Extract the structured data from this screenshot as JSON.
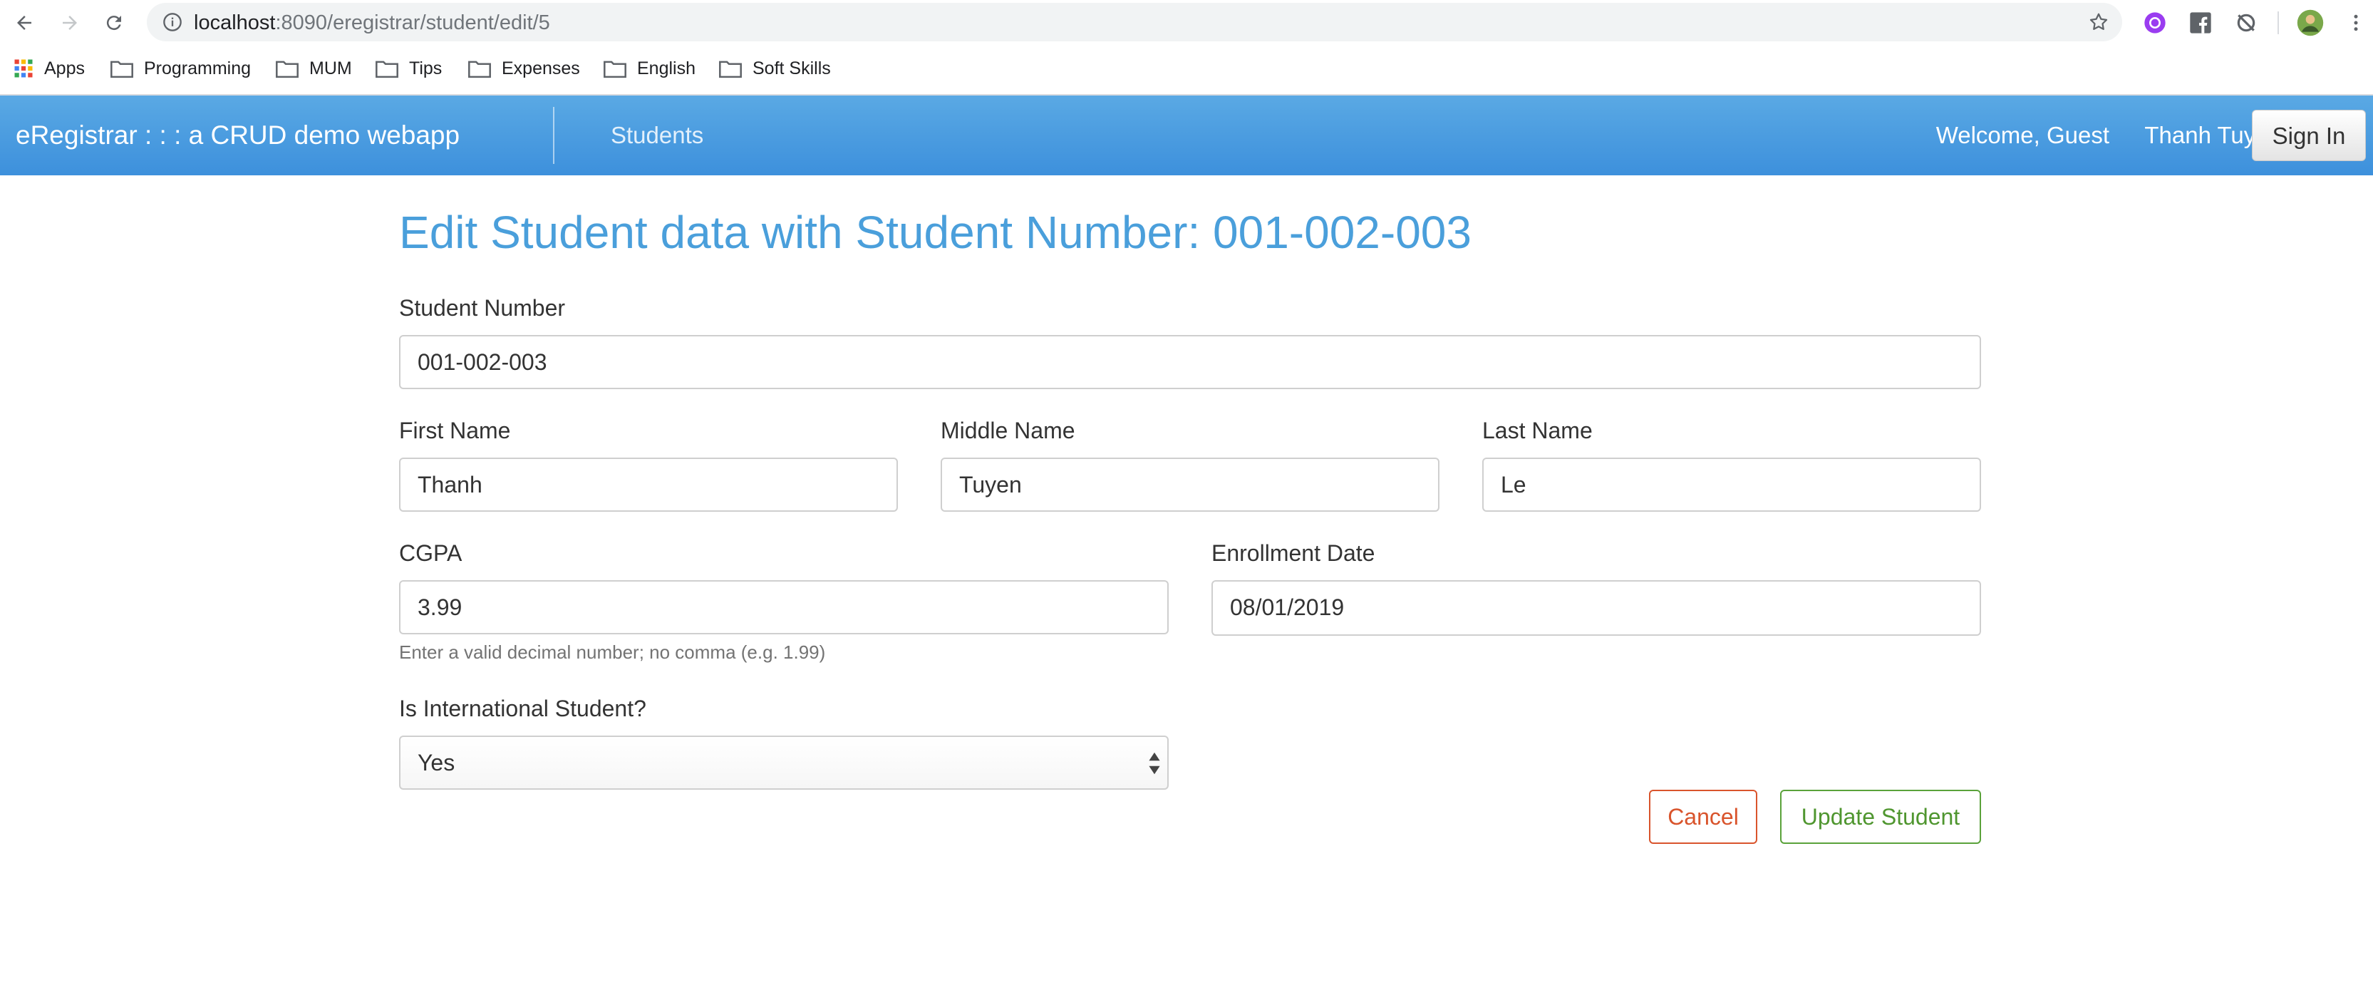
{
  "browser": {
    "url_host": "localhost",
    "url_rest": ":8090/eregistrar/student/edit/5",
    "bookmarks": [
      {
        "label": "Apps",
        "icon": "apps-grid-icon"
      },
      {
        "label": "Programming",
        "icon": "folder-icon"
      },
      {
        "label": "MUM",
        "icon": "folder-icon"
      },
      {
        "label": "Tips",
        "icon": "folder-icon"
      },
      {
        "label": "Expenses",
        "icon": "folder-icon"
      },
      {
        "label": "English",
        "icon": "folder-icon"
      },
      {
        "label": "Soft Skills",
        "icon": "folder-icon"
      }
    ]
  },
  "navbar": {
    "brand": "eRegistrar : : : a CRUD demo webapp",
    "students_link": "Students",
    "welcome": "Welcome, Guest",
    "user_name": "Thanh Tuyen",
    "signin_label": "Sign In",
    "colors": {
      "bar_top": "#5aa9e4",
      "bar_bottom": "#3d90dc"
    }
  },
  "form": {
    "title": "Edit Student data with Student Number: 001-002-003",
    "student_number_label": "Student Number",
    "student_number_value": "001-002-003",
    "first_name_label": "First Name",
    "first_name_value": "Thanh",
    "middle_name_label": "Middle Name",
    "middle_name_value": "Tuyen",
    "last_name_label": "Last Name",
    "last_name_value": "Le",
    "cgpa_label": "CGPA",
    "cgpa_value": "3.99",
    "cgpa_help": "Enter a valid decimal number; no comma (e.g. 1.99)",
    "enrollment_label": "Enrollment Date",
    "enrollment_value": "08/01/2019",
    "international_label": "Is International Student?",
    "international_value": "Yes",
    "cancel_label": "Cancel",
    "update_label": "Update Student",
    "colors": {
      "title": "#4a9fdb",
      "cancel": "#d9542c",
      "update": "#5aa23a"
    }
  }
}
